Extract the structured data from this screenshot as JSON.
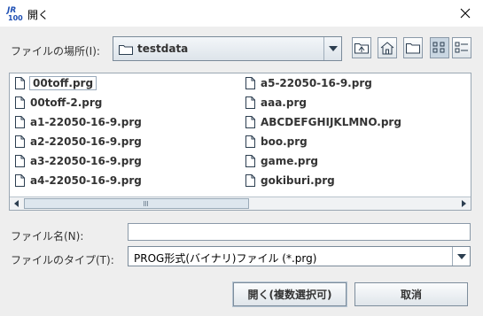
{
  "window": {
    "title": "開く",
    "app_icon_text": "JR 100"
  },
  "look_in": {
    "label": "ファイルの場所(I):",
    "value": "testdata"
  },
  "files": {
    "col1": [
      "00toff.prg",
      "00toff-2.prg",
      "a1-22050-16-9.prg",
      "a2-22050-16-9.prg",
      "a3-22050-16-9.prg",
      "a4-22050-16-9.prg"
    ],
    "col2": [
      "a5-22050-16-9.prg",
      "aaa.prg",
      "ABCDEFGHIJKLMNO.prg",
      "boo.prg",
      "game.prg",
      "gokiburi.prg"
    ],
    "selected": "00toff.prg"
  },
  "file_name": {
    "label": "ファイル名(N):",
    "value": ""
  },
  "file_type": {
    "label": "ファイルのタイプ(T):",
    "value": "PROG形式(バイナリ)ファイル (*.prg)"
  },
  "buttons": {
    "open": "開く(複数選択可)",
    "cancel": "取消"
  }
}
